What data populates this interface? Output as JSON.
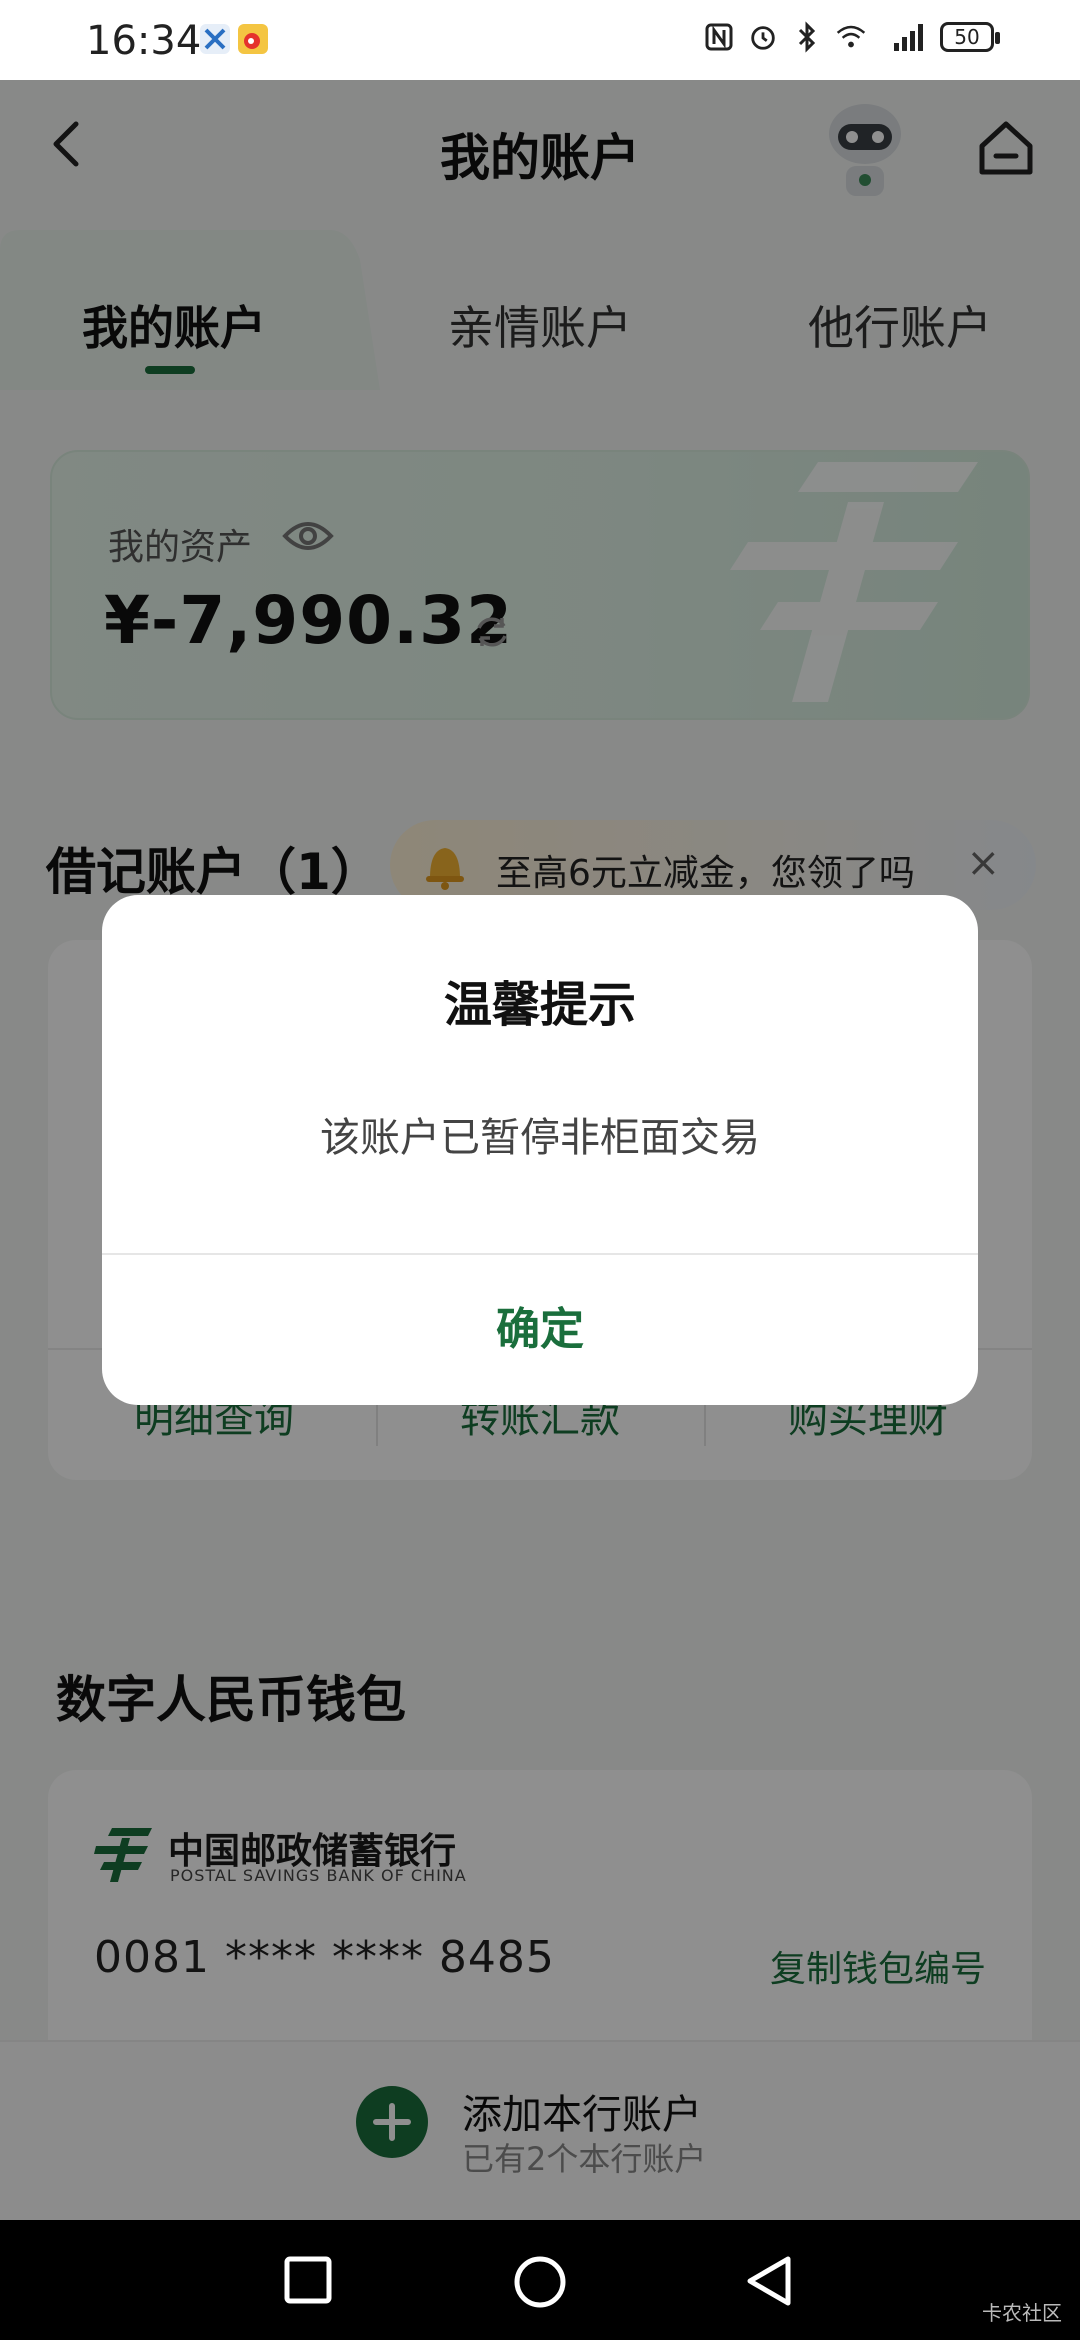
{
  "status_bar": {
    "time": "16:34",
    "battery": "50",
    "signal": "4G",
    "icons": [
      "nfc-icon",
      "alarm-icon",
      "bluetooth-icon",
      "wifi-icon",
      "signal-icon"
    ]
  },
  "header": {
    "title": "我的账户"
  },
  "tabs": [
    {
      "label": "我的账户",
      "active": true
    },
    {
      "label": "亲情账户",
      "active": false
    },
    {
      "label": "他行账户",
      "active": false
    }
  ],
  "assets": {
    "label": "我的资产",
    "value": "¥-7,990.32"
  },
  "debit": {
    "title": "借记账户（1）",
    "promo": "至高6元立减金，您领了吗",
    "close_glyph": "×",
    "actions": [
      "明细查询",
      "转账汇款",
      "购买理财"
    ]
  },
  "wallet": {
    "title": "数字人民币钱包",
    "bank_name_cn": "中国邮政储蓄银行",
    "bank_name_en": "POSTAL SAVINGS BANK OF CHINA",
    "number": "0081 **** **** 8485",
    "copy_label": "复制钱包编号"
  },
  "add_account": {
    "title": "添加本行账户",
    "subtitle": "已有2个本行账户"
  },
  "dialog": {
    "title": "温馨提示",
    "message": "该账户已暂停非柜面交易",
    "confirm": "确定"
  },
  "watermark": "卡农社区",
  "colors": {
    "accent": "#1a6e3c",
    "overlay": "rgba(0,0,0,0.44)"
  }
}
